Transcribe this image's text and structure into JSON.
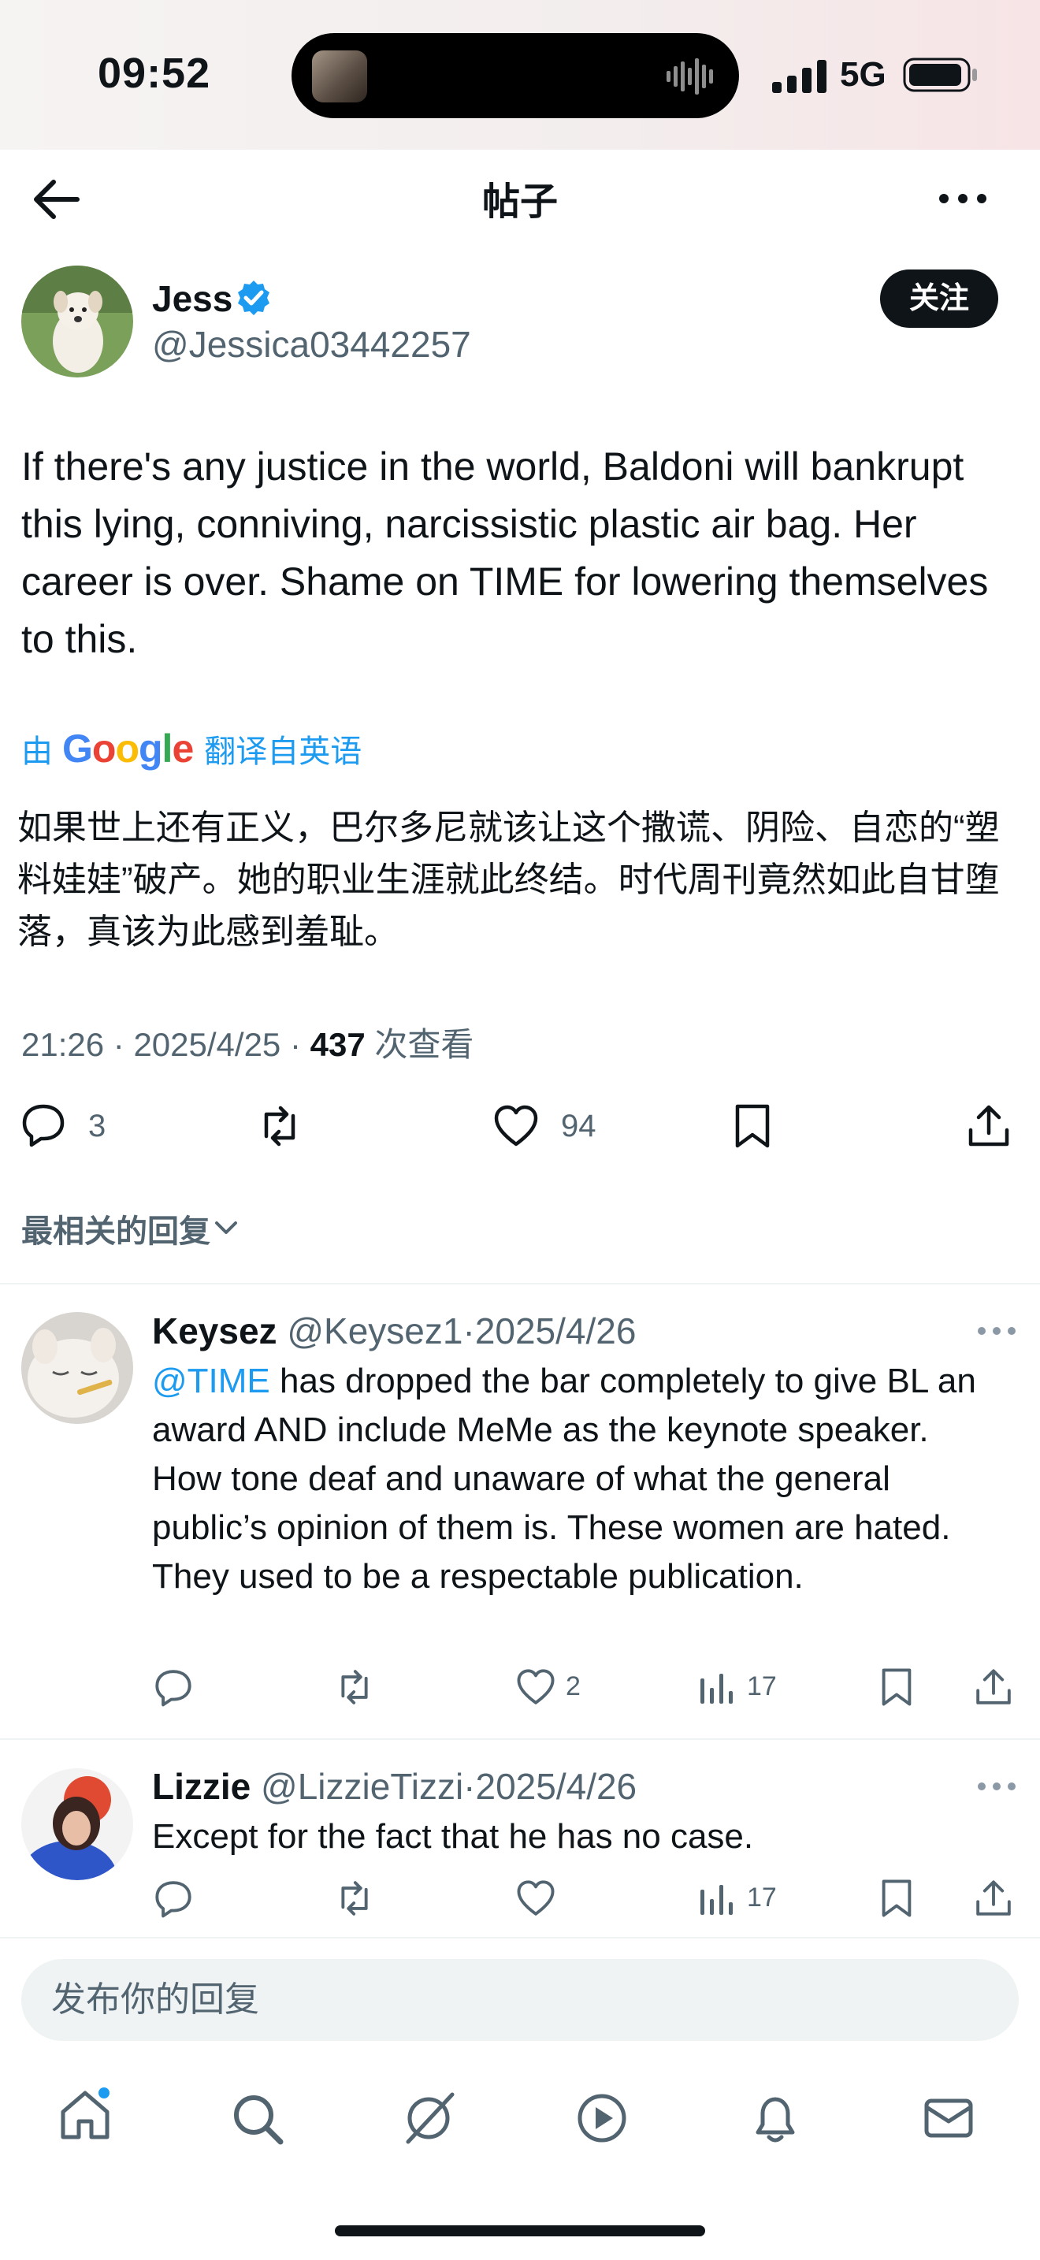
{
  "status_bar": {
    "time": "09:52",
    "network": "5G"
  },
  "nav": {
    "title": "帖子"
  },
  "post": {
    "author_name": "Jess",
    "author_handle": "@Jessica03442257",
    "follow_label": "关注",
    "text": "If there's any justice in the world, Baldoni will bankrupt this lying, conniving, narcissistic plastic air bag. Her career is over. Shame on TIME for lowering themselves to this.",
    "translate_prefix": "由",
    "translate_brand": "Google",
    "translate_suffix": "翻译自英语",
    "translated_text": "如果世上还有正义，巴尔多尼就该让这个撒谎、阴险、自恋的“塑料娃娃”破产。她的职业生涯就此终结。时代周刊竟然如此自甘堕落，真该为此感到羞耻。",
    "time": "21:26",
    "date": "2025/4/25",
    "views": "437",
    "views_label": "次查看",
    "replies": "3",
    "likes": "94"
  },
  "sort_label": "最相关的回复",
  "replies": [
    {
      "name": "Keysez",
      "handle": "@Keysez1",
      "date": "2025/4/26",
      "mention": "@TIME",
      "text": " has dropped the bar completely to give BL an award AND include MeMe as the keynote speaker. How tone deaf and unaware of what the general public’s opinion of them is. These women are hated. They used to be a respectable publication.",
      "likes": "2",
      "views": "17"
    },
    {
      "name": "Lizzie",
      "handle": "@LizzieTizzi",
      "date": "2025/4/26",
      "text": "Except for the fact that he has no case.",
      "views": "17"
    }
  ],
  "composer": {
    "placeholder": "发布你的回复"
  },
  "google_colors": [
    "#4285f4",
    "#ea4335",
    "#fbbc05",
    "#4285f4",
    "#34a853",
    "#ea4335"
  ],
  "accent_color": "#1d9bf0"
}
